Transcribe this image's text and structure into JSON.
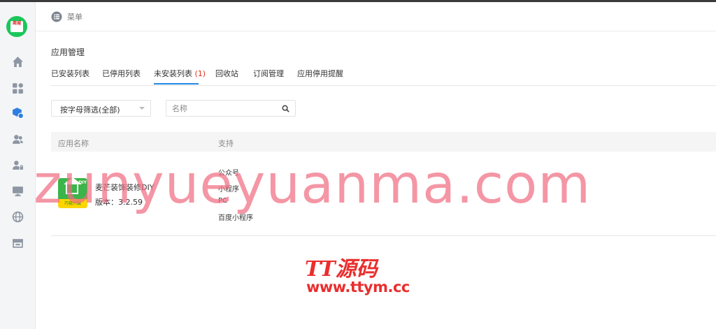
{
  "logo": {
    "text": "商城"
  },
  "header": {
    "menu_label": "菜单"
  },
  "page": {
    "title": "应用管理"
  },
  "tabs": [
    {
      "label": "已安装列表"
    },
    {
      "label": "已停用列表"
    },
    {
      "label": "未安装列表",
      "count": "(1)",
      "active": true
    },
    {
      "label": "回收站"
    },
    {
      "label": "订阅管理"
    },
    {
      "label": "应用停用提醒"
    }
  ],
  "filter": {
    "select_value": "按字母筛选(全部)",
    "search_placeholder": "名称"
  },
  "table": {
    "headers": [
      "应用名称",
      "支持"
    ],
    "rows": [
      {
        "icon": {
          "corner": "DIY",
          "band": "巧极兴装"
        },
        "name": "麦芒装饰装修DIY",
        "version": "版本：3.2.59",
        "support": [
          "公众号",
          "小程序",
          "PC",
          "百度小程序"
        ]
      }
    ]
  },
  "watermark": {
    "text": "zunyueyuanma.com",
    "logo": "TT源码",
    "url": "www.ttym.cc"
  },
  "colors": {
    "accent": "#1e88e5",
    "count": "#e0341f",
    "logo_bg": "#1bc65a",
    "watermark": "#ea2e2e"
  }
}
